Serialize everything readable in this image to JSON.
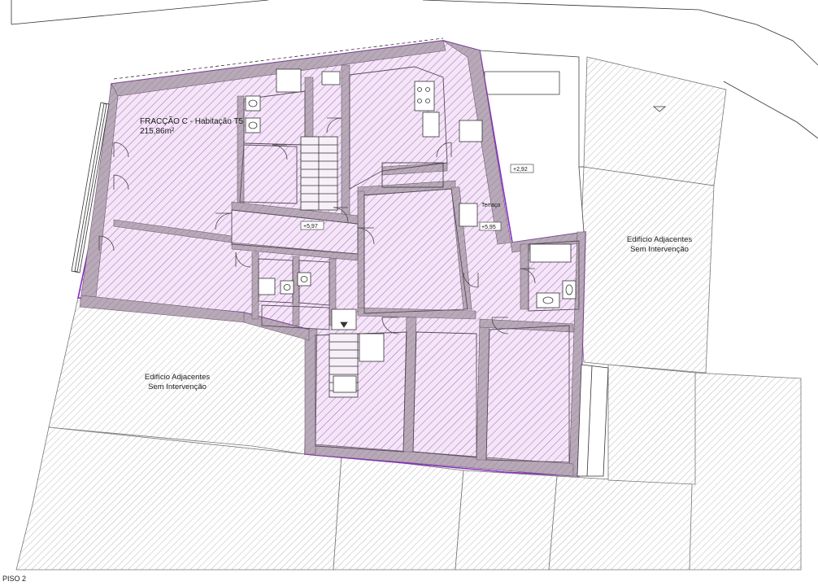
{
  "unit": {
    "title": "FRACÇÃO C - Habitação T5",
    "area": "215,86m²"
  },
  "adjacent": {
    "right": [
      "Edifício Adjacentes",
      "Sem Intervenção"
    ],
    "left": [
      "Edifício Adjacentes",
      "Sem Intervenção"
    ]
  },
  "terrace": {
    "label": "Terraço",
    "level": "+2,92"
  },
  "levels": {
    "corridor": "+5,97",
    "terrace_stair": "+5,95"
  },
  "floor": {
    "label": "PISO 2"
  },
  "colors": {
    "unit_outline": "#8a2fc2",
    "unit_hatch": "#b04fc7",
    "wall_fill": "#b8a9b8",
    "adjacent_hatch": "#9a9a9a"
  }
}
